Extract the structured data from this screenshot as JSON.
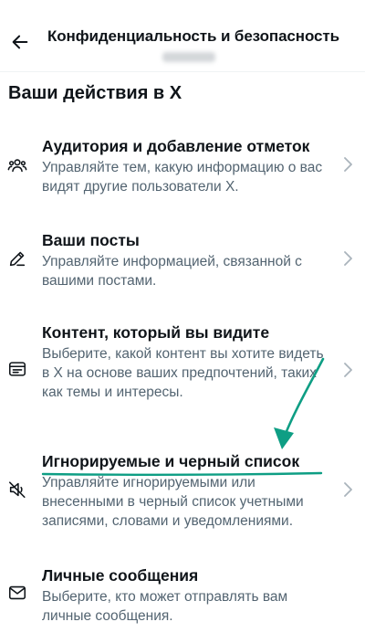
{
  "header": {
    "title": "Конфиденциальность и безопасность",
    "back_icon": "arrow-left-icon"
  },
  "section": {
    "title": "Ваши действия в X"
  },
  "items": [
    {
      "icon": "people-icon",
      "title": "Аудитория и добавление отметок",
      "desc": "Управляйте тем, какую информацию о вас видят другие пользователи X."
    },
    {
      "icon": "pencil-icon",
      "title": "Ваши посты",
      "desc": "Управляйте информацией, связанной с вашими постами."
    },
    {
      "icon": "content-card-icon",
      "title": "Контент, который вы видите",
      "desc": "Выберите, какой контент вы хотите видеть в X на основе ваших предпочтений, таких как темы и интересы."
    },
    {
      "icon": "muted-speaker-icon",
      "title": "Игнорируемые и черный список",
      "desc": "Управляйте игнорируемыми или внесенными в черный список учетными записями, словами и уведомлениями."
    },
    {
      "icon": "envelope-icon",
      "title": "Личные сообщения",
      "desc": "Выберите, кто может отправлять вам личные сообщения."
    }
  ],
  "colors": {
    "text_primary": "#0f1419",
    "text_secondary": "#536471",
    "chevron": "#aab4bc",
    "annotation": "#0e9e84"
  }
}
